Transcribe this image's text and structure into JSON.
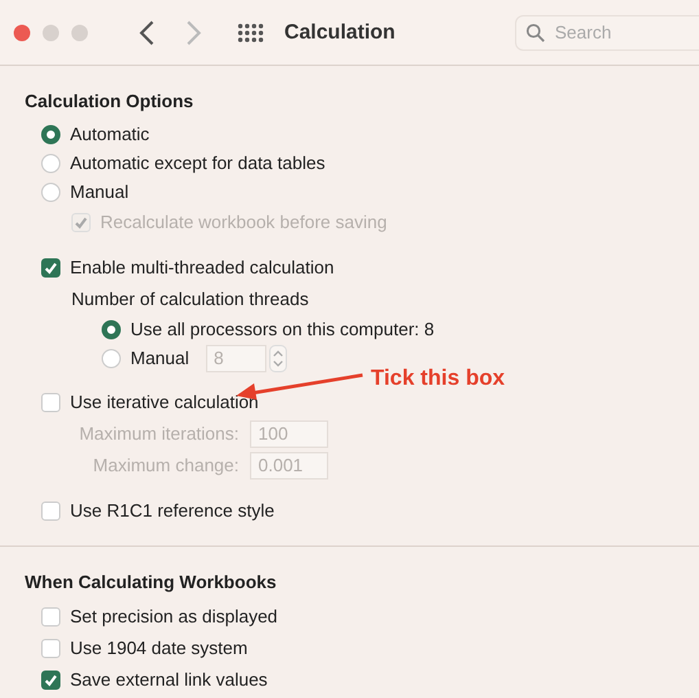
{
  "toolbar": {
    "title": "Calculation",
    "search": {
      "placeholder": "Search"
    }
  },
  "sections": [
    {
      "heading": "Calculation Options",
      "groups": [
        [
          {
            "kind": "radio",
            "label": "Automatic",
            "selected": true
          },
          {
            "kind": "radio",
            "label": "Automatic except for data tables",
            "selected": false
          },
          {
            "kind": "radio",
            "label": "Manual",
            "selected": false,
            "children": [
              {
                "kind": "checkbox",
                "label": "Recalculate workbook before saving",
                "checked": true,
                "disabled": true
              }
            ]
          }
        ],
        [
          {
            "kind": "checkbox",
            "label": "Enable multi-threaded calculation",
            "checked": true,
            "disabled": false,
            "children": [
              {
                "kind": "label",
                "label": "Number of calculation threads",
                "children": [
                  {
                    "kind": "radio",
                    "label": "Use all processors on this computer: 8",
                    "selected": true
                  },
                  {
                    "kind": "radio",
                    "label": "Manual",
                    "selected": false,
                    "field": {
                      "value": "8",
                      "disabled": true
                    }
                  }
                ]
              }
            ]
          }
        ],
        [
          {
            "kind": "checkbox",
            "label": "Use iterative calculation",
            "checked": false,
            "disabled": false,
            "children": [
              {
                "kind": "field",
                "label": "Maximum iterations:",
                "value": "100",
                "disabled": true
              },
              {
                "kind": "field",
                "label": "Maximum change:",
                "value": "0.001",
                "disabled": true
              }
            ]
          }
        ],
        [
          {
            "kind": "checkbox",
            "label": "Use R1C1 reference style",
            "checked": false,
            "disabled": false
          }
        ]
      ]
    },
    {
      "heading": "When Calculating Workbooks",
      "groups": [
        [
          {
            "kind": "checkbox",
            "label": "Set precision as displayed",
            "checked": false,
            "disabled": false
          },
          {
            "kind": "checkbox",
            "label": "Use 1904 date system",
            "checked": false,
            "disabled": false
          },
          {
            "kind": "checkbox",
            "label": "Save external link values",
            "checked": true,
            "disabled": false
          }
        ]
      ]
    }
  ],
  "annotation": {
    "text": "Tick this box"
  }
}
